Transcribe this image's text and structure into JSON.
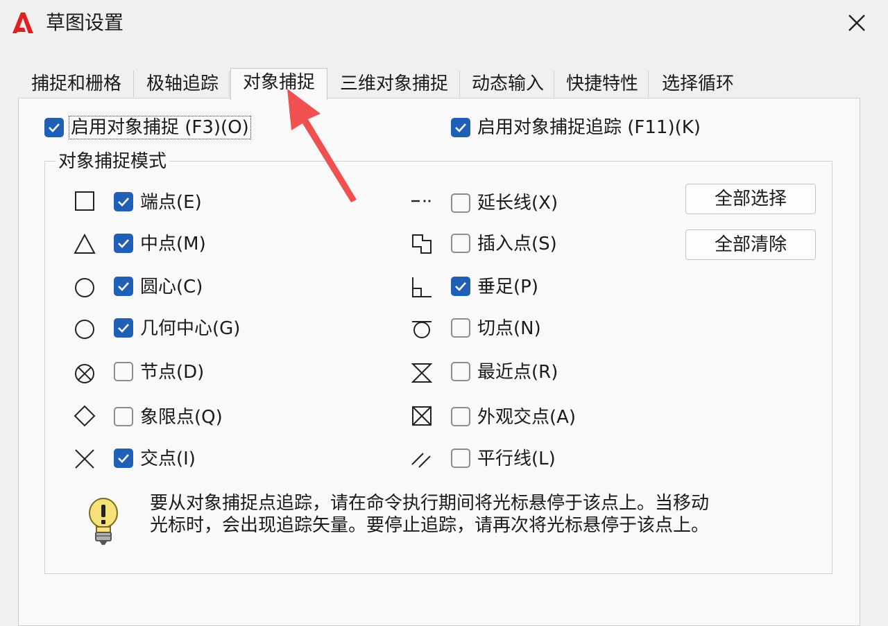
{
  "window": {
    "title": "草图设置",
    "close_icon": "close-icon",
    "logo_icon": "autocad-logo-icon",
    "accent": "#1f5fb5",
    "logo_color": "#e02020"
  },
  "tabs": [
    {
      "label": "捕捉和栅格",
      "active": false
    },
    {
      "label": "极轴追踪",
      "active": false
    },
    {
      "label": "对象捕捉",
      "active": true
    },
    {
      "label": "三维对象捕捉",
      "active": false
    },
    {
      "label": "动态输入",
      "active": false
    },
    {
      "label": "快捷特性",
      "active": false
    },
    {
      "label": "选择循环",
      "active": false
    }
  ],
  "options": {
    "enable_osnap": {
      "label": "启用对象捕捉 (F3)(O)",
      "checked": true
    },
    "enable_tracking": {
      "label": "启用对象捕捉追踪 (F11)(K)",
      "checked": true
    }
  },
  "mode_group": {
    "title": "对象捕捉模式",
    "left": [
      {
        "label": "端点(E)",
        "checked": true,
        "icon": "endpoint-square-icon"
      },
      {
        "label": "中点(M)",
        "checked": true,
        "icon": "midpoint-triangle-icon"
      },
      {
        "label": "圆心(C)",
        "checked": true,
        "icon": "center-circle-icon"
      },
      {
        "label": "几何中心(G)",
        "checked": true,
        "icon": "geometric-center-circle-icon"
      },
      {
        "label": "节点(D)",
        "checked": false,
        "icon": "node-icon"
      },
      {
        "label": "象限点(Q)",
        "checked": false,
        "icon": "quadrant-diamond-icon"
      },
      {
        "label": "交点(I)",
        "checked": true,
        "icon": "intersection-x-icon"
      }
    ],
    "right": [
      {
        "label": "延长线(X)",
        "checked": false,
        "icon": "extension-icon"
      },
      {
        "label": "插入点(S)",
        "checked": false,
        "icon": "insertion-icon"
      },
      {
        "label": "垂足(P)",
        "checked": true,
        "icon": "perpendicular-icon"
      },
      {
        "label": "切点(N)",
        "checked": false,
        "icon": "tangent-icon"
      },
      {
        "label": "最近点(R)",
        "checked": false,
        "icon": "nearest-hourglass-icon"
      },
      {
        "label": "外观交点(A)",
        "checked": false,
        "icon": "apparent-intersection-icon"
      },
      {
        "label": "平行线(L)",
        "checked": false,
        "icon": "parallel-icon"
      }
    ],
    "select_all_label": "全部选择",
    "clear_all_label": "全部清除"
  },
  "hint": {
    "icon": "lightbulb-icon",
    "line1": "要从对象捕捉点追踪，请在命令执行期间将光标悬停于该点上。当移动",
    "line2": "光标时，会出现追踪矢量。要停止追踪，请再次将光标悬停于该点上。"
  },
  "annotation": {
    "icon": "red-arrow-icon",
    "color": "#f05050"
  }
}
